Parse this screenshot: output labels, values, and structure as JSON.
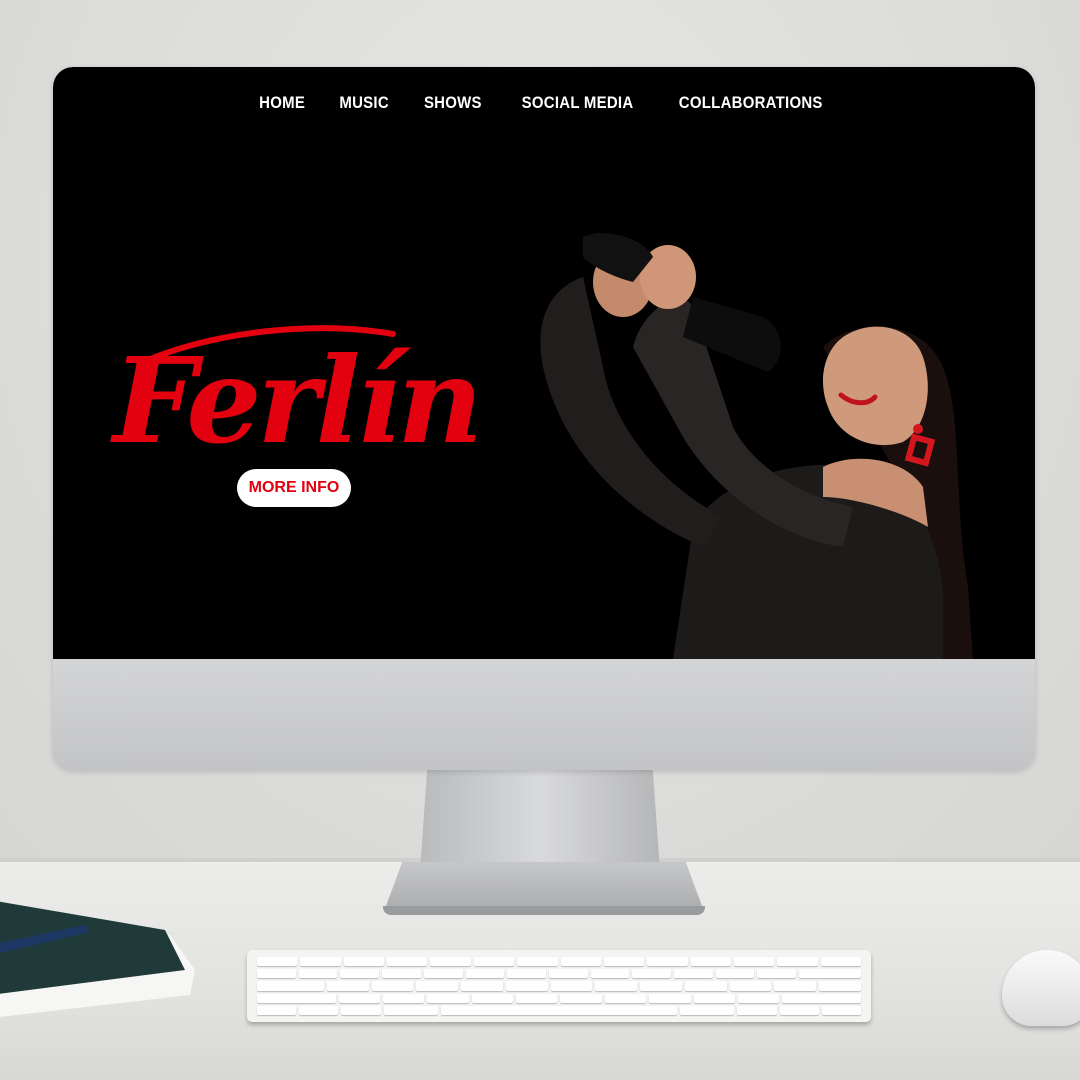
{
  "nav": {
    "items": [
      {
        "label": "HOME"
      },
      {
        "label": "MUSIC"
      },
      {
        "label": "SHOWS"
      },
      {
        "label": "SOCIAL MEDIA"
      },
      {
        "label": "COLLABORATIONS"
      }
    ]
  },
  "hero": {
    "logo_text": "Ferlín",
    "button_label": "MORE INFO"
  },
  "colors": {
    "accent": "#e3000f",
    "background": "#000000",
    "nav_text": "#ffffff"
  }
}
